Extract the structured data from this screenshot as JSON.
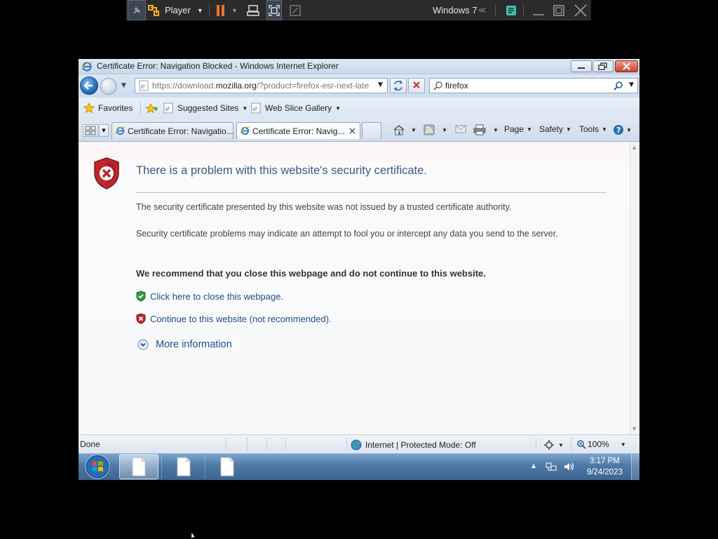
{
  "vm_toolbar": {
    "player_label": "Player",
    "vm_name": "Windows 7"
  },
  "window": {
    "title": "Certificate Error: Navigation Blocked - Windows Internet Explorer"
  },
  "address_bar": {
    "url_prefix": "https://download.",
    "url_domain": "mozilla.org",
    "url_suffix": "/?product=firefox-esr-next-late"
  },
  "search_box": {
    "value": "firefox"
  },
  "favorites_bar": {
    "favorites_label": "Favorites",
    "items": [
      {
        "label": "Suggested Sites"
      },
      {
        "label": "Web Slice Gallery"
      }
    ]
  },
  "tabs": [
    {
      "label": "Certificate Error: Navigatio...",
      "active": false
    },
    {
      "label": "Certificate Error: Navig...",
      "active": true
    }
  ],
  "command_bar": {
    "page_label": "Page",
    "safety_label": "Safety",
    "tools_label": "Tools"
  },
  "content": {
    "heading": "There is a problem with this website's security certificate.",
    "para1": "The security certificate presented by this website was not issued by a trusted certificate authority.",
    "para2": "Security certificate problems may indicate an attempt to fool you or intercept any data you send to the server.",
    "recommendation": "We recommend that you close this webpage and do not continue to this website.",
    "close_link": "Click here to close this webpage.",
    "continue_link": "Continue to this website (not recommended).",
    "more_info": "More information"
  },
  "status_bar": {
    "status_text": "Done",
    "zone_text": "Internet | Protected Mode: Off",
    "zoom": "100%"
  },
  "taskbar": {
    "time": "3:17 PM",
    "date": "9/24/2023"
  },
  "colors": {
    "link": "#1f4e8c",
    "heading": "#3c5a80",
    "error_red": "#c0282d",
    "shield_green": "#3a9a3a"
  }
}
